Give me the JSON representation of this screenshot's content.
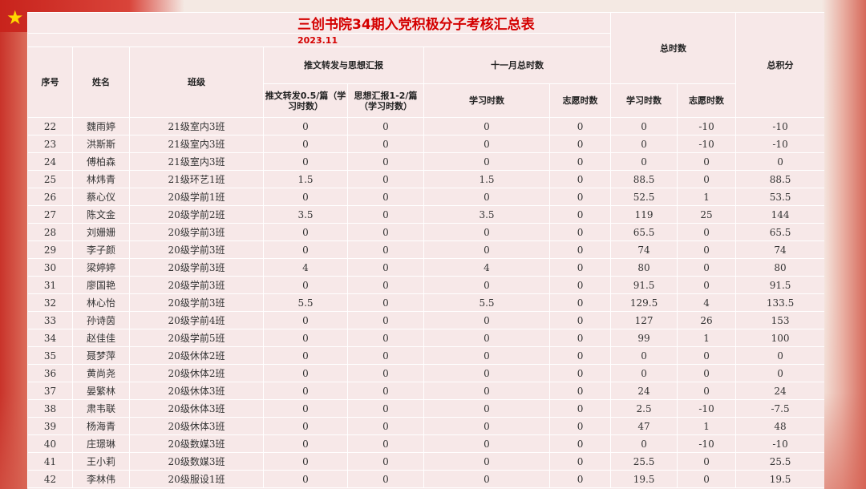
{
  "title": "三创书院34期入党积极分子考核汇总表",
  "date": "2023.11",
  "headers": {
    "seq": "序号",
    "name": "姓名",
    "class": "班级",
    "group_report": "推文转发与思想汇报",
    "group_nov": "十一月总时数",
    "group_total": "总时数",
    "total_score": "总积分",
    "repost": "推文转发0.5/篇（学习时数）",
    "thought_report": "思想汇报1-2/篇（学习时数）",
    "nov_study": "学习时数",
    "nov_volunteer": "志愿时数",
    "total_study": "学习时数",
    "total_volunteer": "志愿时数"
  },
  "rows": [
    [
      "22",
      "魏雨婷",
      "21级室内3班",
      "0",
      "0",
      "0",
      "0",
      "0",
      "-10",
      "-10"
    ],
    [
      "23",
      "洪斯斯",
      "21级室内3班",
      "0",
      "0",
      "0",
      "0",
      "0",
      "-10",
      "-10"
    ],
    [
      "24",
      "傅柏森",
      "21级室内3班",
      "0",
      "0",
      "0",
      "0",
      "0",
      "0",
      "0"
    ],
    [
      "25",
      "林炜青",
      "21级环艺1班",
      "1.5",
      "0",
      "1.5",
      "0",
      "88.5",
      "0",
      "88.5"
    ],
    [
      "26",
      "蔡心仪",
      "20级学前1班",
      "0",
      "0",
      "0",
      "0",
      "52.5",
      "1",
      "53.5"
    ],
    [
      "27",
      "陈文金",
      "20级学前2班",
      "3.5",
      "0",
      "3.5",
      "0",
      "119",
      "25",
      "144"
    ],
    [
      "28",
      "刘姗姗",
      "20级学前3班",
      "0",
      "0",
      "0",
      "0",
      "65.5",
      "0",
      "65.5"
    ],
    [
      "29",
      "李子颜",
      "20级学前3班",
      "0",
      "0",
      "0",
      "0",
      "74",
      "0",
      "74"
    ],
    [
      "30",
      "梁婷婷",
      "20级学前3班",
      "4",
      "0",
      "4",
      "0",
      "80",
      "0",
      "80"
    ],
    [
      "31",
      "廖国艳",
      "20级学前3班",
      "0",
      "0",
      "0",
      "0",
      "91.5",
      "0",
      "91.5"
    ],
    [
      "32",
      "林心怡",
      "20级学前3班",
      "5.5",
      "0",
      "5.5",
      "0",
      "129.5",
      "4",
      "133.5"
    ],
    [
      "33",
      "孙诗茵",
      "20级学前4班",
      "0",
      "0",
      "0",
      "0",
      "127",
      "26",
      "153"
    ],
    [
      "34",
      "赵佳佳",
      "20级学前5班",
      "0",
      "0",
      "0",
      "0",
      "99",
      "1",
      "100"
    ],
    [
      "35",
      "聂梦萍",
      "20级休体2班",
      "0",
      "0",
      "0",
      "0",
      "0",
      "0",
      "0"
    ],
    [
      "36",
      "黄尚尧",
      "20级休体2班",
      "0",
      "0",
      "0",
      "0",
      "0",
      "0",
      "0"
    ],
    [
      "37",
      "晏繁林",
      "20级休体3班",
      "0",
      "0",
      "0",
      "0",
      "24",
      "0",
      "24"
    ],
    [
      "38",
      "肃韦联",
      "20级休体3班",
      "0",
      "0",
      "0",
      "0",
      "2.5",
      "-10",
      "-7.5"
    ],
    [
      "39",
      "杨海青",
      "20级休体3班",
      "0",
      "0",
      "0",
      "0",
      "47",
      "1",
      "48"
    ],
    [
      "40",
      "庄璟琳",
      "20级数媒3班",
      "0",
      "0",
      "0",
      "0",
      "0",
      "-10",
      "-10"
    ],
    [
      "41",
      "王小莉",
      "20级数媒3班",
      "0",
      "0",
      "0",
      "0",
      "25.5",
      "0",
      "25.5"
    ],
    [
      "42",
      "李林伟",
      "20级服设1班",
      "0",
      "0",
      "0",
      "0",
      "19.5",
      "0",
      "19.5"
    ]
  ]
}
